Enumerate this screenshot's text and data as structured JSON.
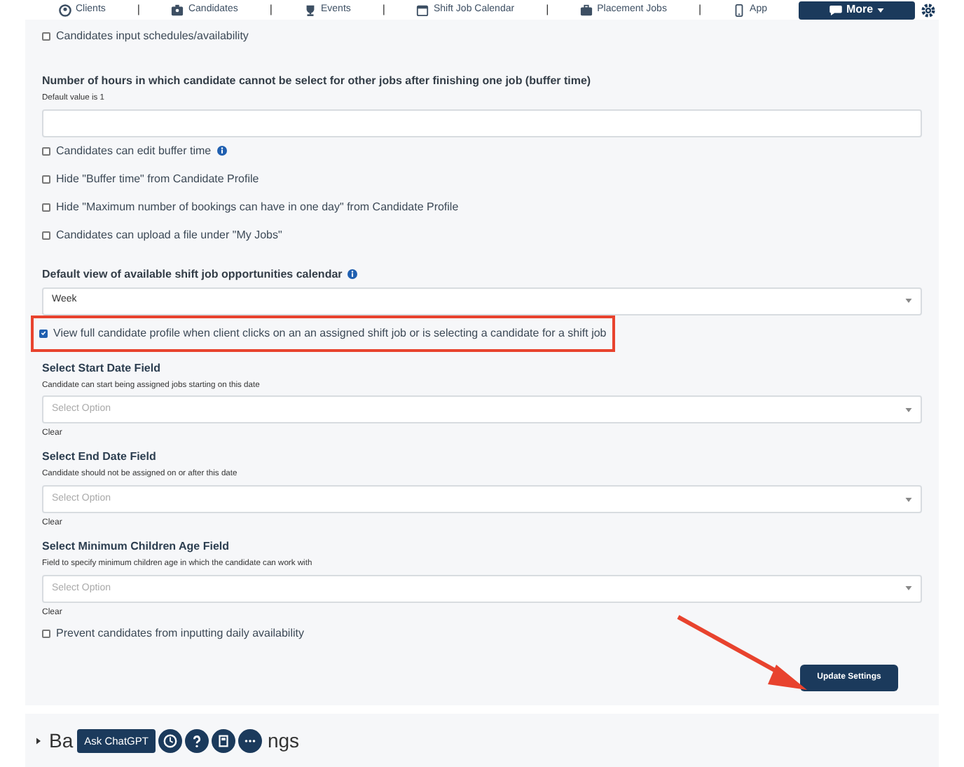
{
  "nav": {
    "items": [
      {
        "label": "Clients"
      },
      {
        "label": "Candidates"
      },
      {
        "label": "Events"
      },
      {
        "label": "Shift Job Calendar"
      },
      {
        "label": "Placement Jobs"
      },
      {
        "label": "App"
      }
    ],
    "separators": [
      "|",
      "|",
      "|",
      "|",
      "|"
    ],
    "more_button": "More"
  },
  "fields": [
    {
      "kind": "checkbox",
      "label": "Candidates input schedules/availability",
      "checked": false
    },
    {
      "kind": "text",
      "label": "Number of hours in which candidate cannot be select for other jobs after finishing one job (buffer time)",
      "help": "Default value is 1"
    },
    {
      "kind": "checkbox",
      "label": "Candidates can edit buffer time",
      "checked": false,
      "info": true
    },
    {
      "kind": "checkbox",
      "label": "Hide \"Buffer time\" from Candidate Profile",
      "checked": false
    },
    {
      "kind": "checkbox",
      "label": "Hide \"Maximum number of bookings can have in one day\" from Candidate Profile",
      "checked": false
    },
    {
      "kind": "checkbox",
      "label": "Candidates can upload a file under \"My Jobs\"",
      "checked": false
    },
    {
      "kind": "select",
      "label": "Default view of available shift job opportunities calendar",
      "info": true,
      "value": "Week"
    },
    {
      "kind": "checkbox",
      "label": "View full candidate profile when client clicks on an an assigned shift job or is selecting a candidate for a shift job",
      "checked": true,
      "highlighted": true
    },
    {
      "kind": "picker",
      "label": "Select Start Date Field",
      "help": "Candidate can start being assigned jobs starting on this date",
      "placeholder": "Select Option",
      "clear": "Clear"
    },
    {
      "kind": "picker",
      "label": "Select End Date Field",
      "help": "Candidate should not be assigned on or after this date",
      "placeholder": "Select Option",
      "clear": "Clear"
    },
    {
      "kind": "picker",
      "label": "Select Minimum Children Age Field",
      "help": "Field to specify minimum children age in which the candidate can work with",
      "placeholder": "Select Option",
      "clear": "Clear"
    },
    {
      "kind": "checkbox",
      "label": "Prevent candidates from inputting daily availability",
      "checked": false
    }
  ],
  "update_button": "Update Settings",
  "next_section": {
    "heading_start": "Ba",
    "heading_end": "ngs"
  },
  "chat_toolbar": {
    "button": "Ask ChatGPT"
  }
}
